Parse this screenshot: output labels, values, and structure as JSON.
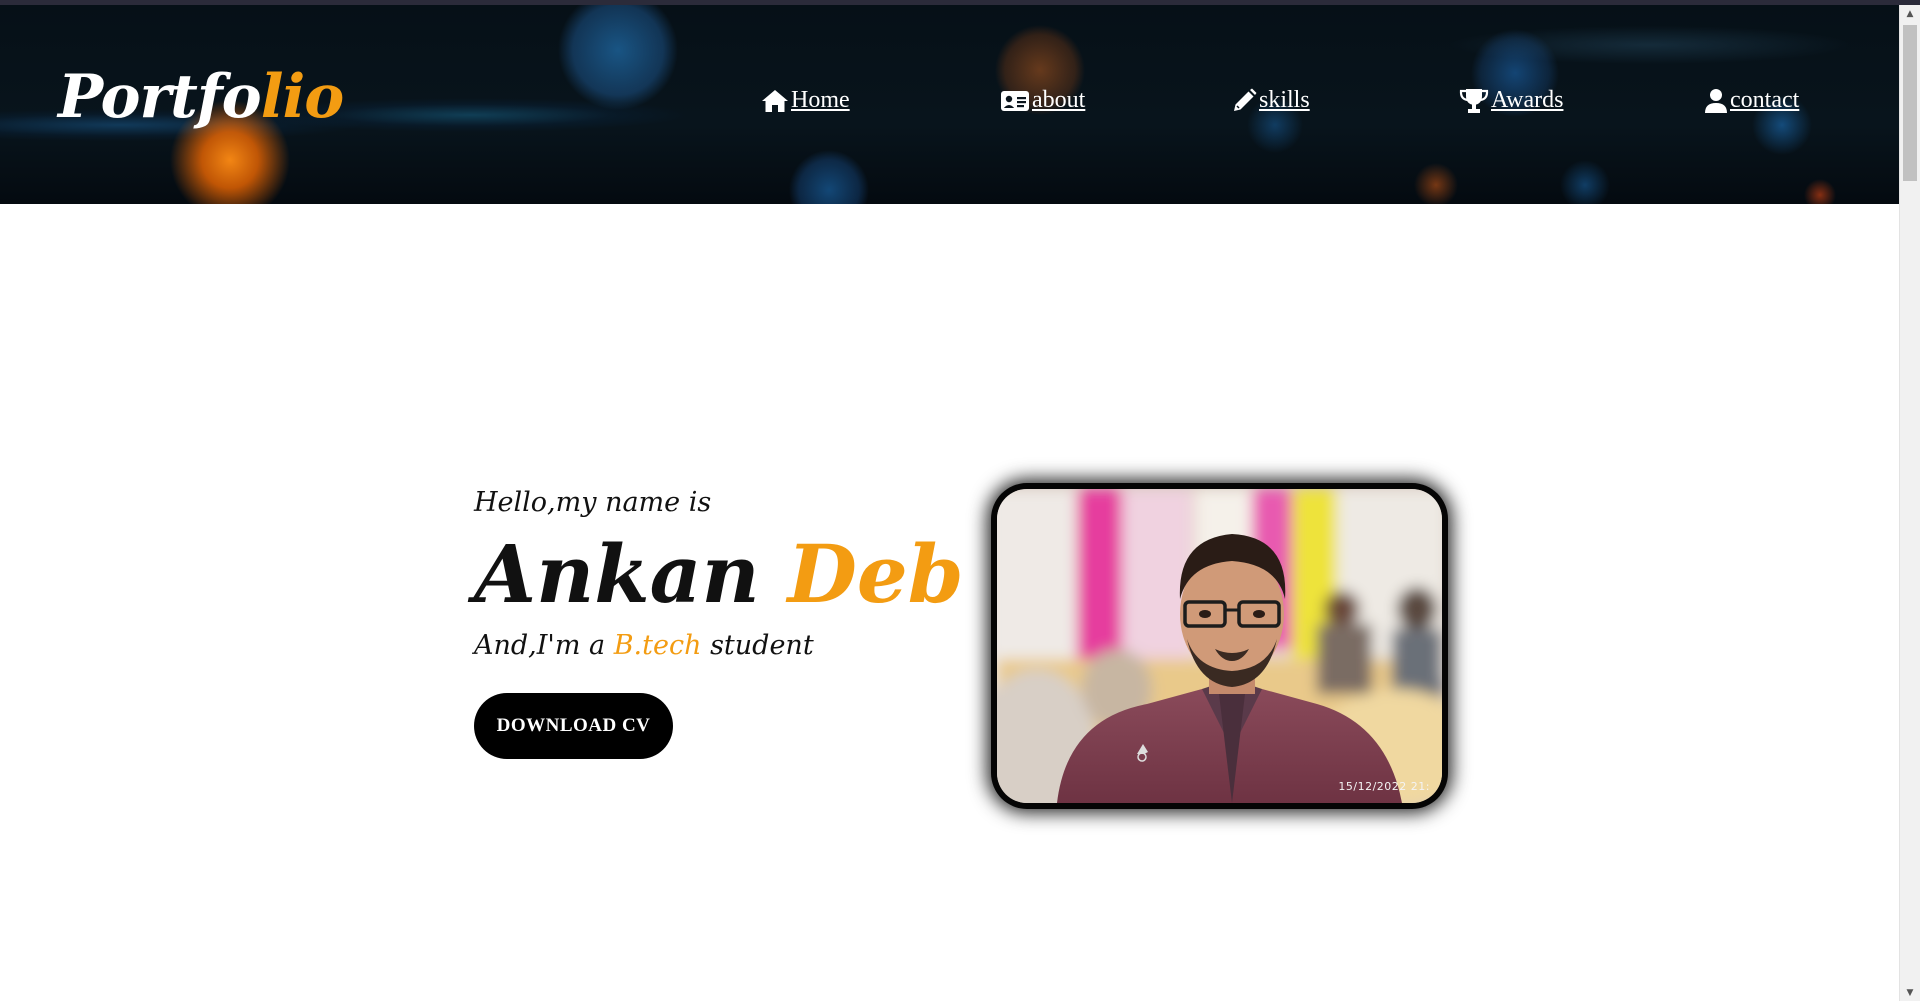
{
  "header": {
    "logo_main": "Portfo",
    "logo_accent": "lio"
  },
  "nav": {
    "items": [
      {
        "label": " Home",
        "icon": "home-icon"
      },
      {
        "label": " about",
        "icon": "id-card-icon"
      },
      {
        "label": " skills",
        "icon": "pencil-icon"
      },
      {
        "label": "Awards",
        "icon": "trophy-icon"
      },
      {
        "label": " contact",
        "icon": "user-icon"
      }
    ]
  },
  "hero": {
    "greeting": "Hello,my name is",
    "first_name": "Ankan",
    "last_name": "Deb",
    "role_prefix": "And,I'm a ",
    "role_highlight": "B.tech",
    "role_suffix": " student",
    "cv_button": "DOWNLOAD CV"
  },
  "photo": {
    "timestamp": "15/12/2022  21:"
  },
  "colors": {
    "accent": "#f39c12",
    "text": "#111111",
    "button_bg": "#000000"
  }
}
